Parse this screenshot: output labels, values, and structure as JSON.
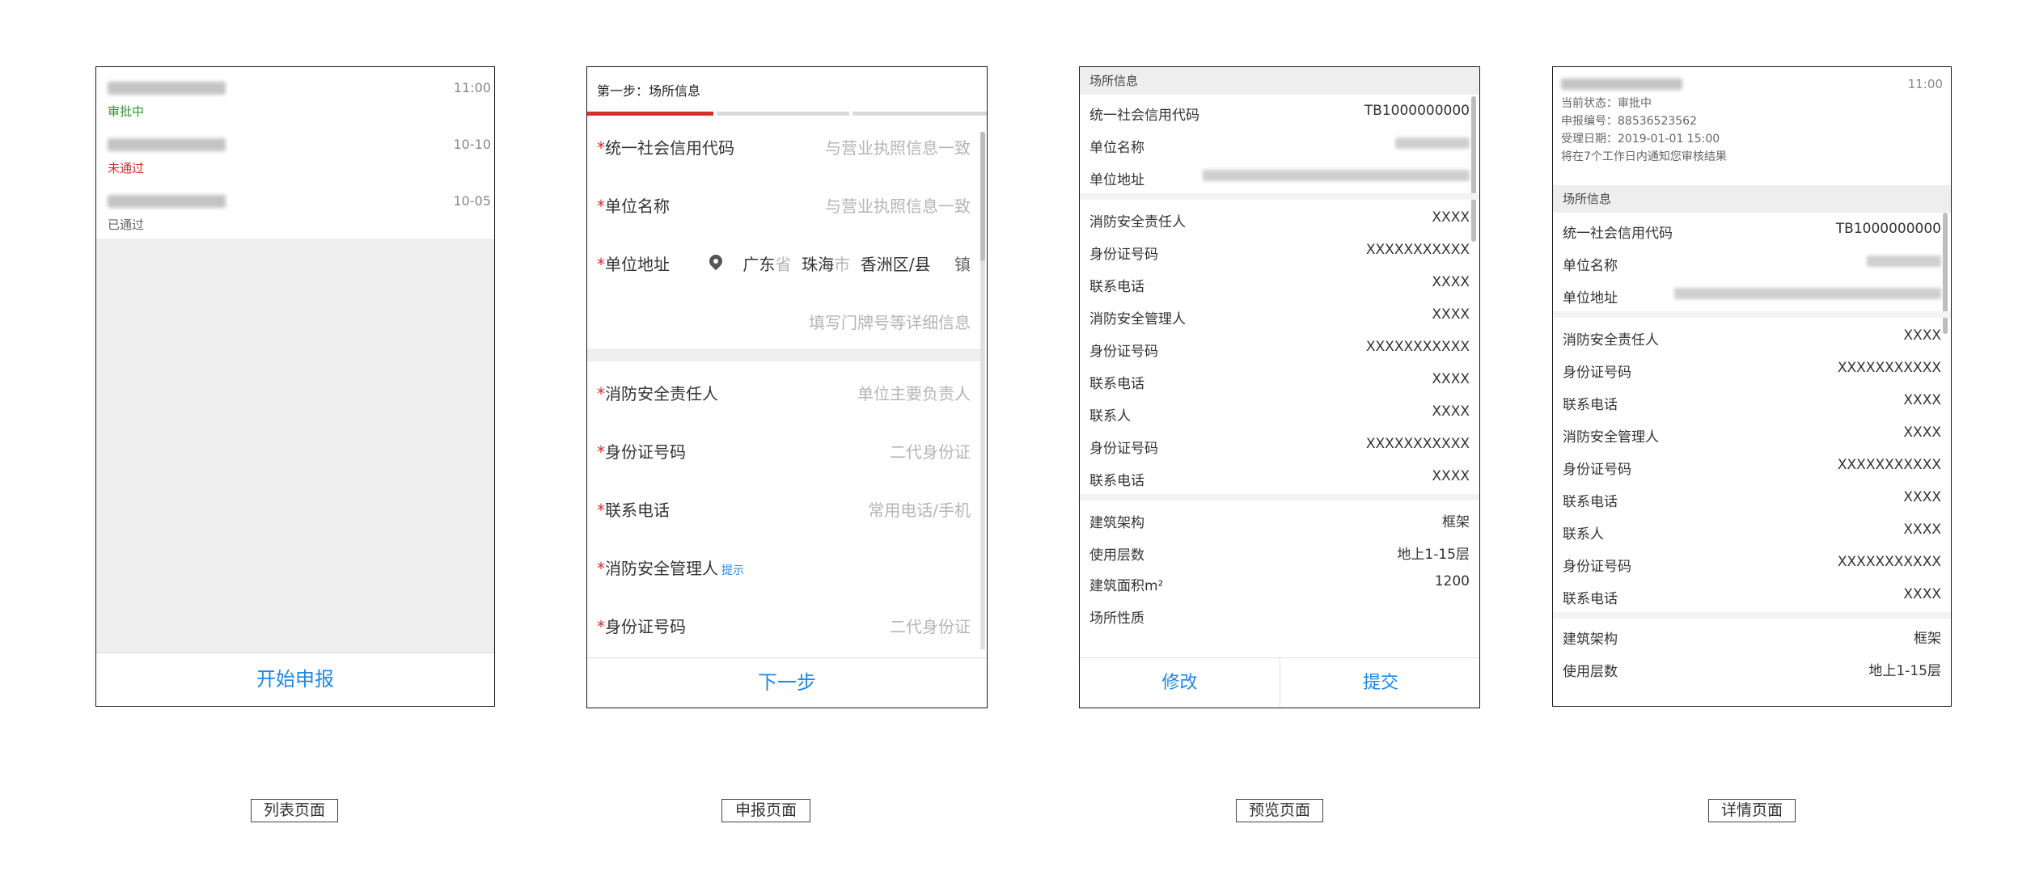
{
  "list_page": {
    "items": [
      {
        "status": "审批中",
        "status_color": "#2e9a2e",
        "time": "11:00"
      },
      {
        "status": "未通过",
        "status_color": "#d32f2f",
        "time": "10-10"
      },
      {
        "status": "已通过",
        "status_color": "#666666",
        "time": "10-05"
      }
    ],
    "start_button": "开始申报",
    "caption": "列表页面"
  },
  "form_page": {
    "step_title": "第一步：场所信息",
    "fields": [
      {
        "label": "统一社会信用代码",
        "placeholder": "与营业执照信息一致"
      },
      {
        "label": "单位名称",
        "placeholder": "与营业执照信息一致"
      },
      {
        "label": "单位地址"
      },
      {
        "placeholder": "填写门牌号等详细信息"
      },
      {
        "label": "消防安全责任人",
        "placeholder": "单位主要负责人"
      },
      {
        "label": "身份证号码",
        "placeholder": "二代身份证"
      },
      {
        "label": "联系电话",
        "placeholder": "常用电话/手机"
      },
      {
        "label": "消防安全管理人",
        "hint": "提示"
      },
      {
        "label": "身份证号码",
        "placeholder": "二代身份证"
      }
    ],
    "required_mark": "*",
    "address": {
      "province": "广东",
      "province_unit": "省",
      "city": "珠海",
      "city_unit": "市",
      "district": "香洲区/县",
      "town": "镇"
    },
    "next_button": "下一步",
    "caption": "申报页面",
    "accent_color": "#d32f2f"
  },
  "preview_page": {
    "section_title": "场所信息",
    "org_rows": [
      {
        "label": "统一社会信用代码",
        "value": "TB1000000000"
      },
      {
        "label": "单位名称"
      },
      {
        "label": "单位地址"
      }
    ],
    "person_rows": [
      {
        "label": "消防安全责任人",
        "value": "XXXX"
      },
      {
        "label": "身份证号码",
        "value": "XXXXXXXXXXX"
      },
      {
        "label": "联系电话",
        "value": "XXXX"
      },
      {
        "label": "消防安全管理人",
        "value": "XXXX"
      },
      {
        "label": "身份证号码",
        "value": "XXXXXXXXXXX"
      },
      {
        "label": "联系电话",
        "value": "XXXX"
      },
      {
        "label": "联系人",
        "value": "XXXX"
      },
      {
        "label": "身份证号码",
        "value": "XXXXXXXXXXX"
      },
      {
        "label": "联系电话",
        "value": "XXXX"
      }
    ],
    "building_rows": [
      {
        "label": "建筑架构",
        "value": "框架"
      },
      {
        "label": "使用层数",
        "value": "地上1-15层"
      },
      {
        "label": "建筑面积m²",
        "value": "1200"
      },
      {
        "label": "场所性质",
        "value": ""
      }
    ],
    "edit_button": "修改",
    "submit_button": "提交",
    "caption": "预览页面"
  },
  "detail_page": {
    "time": "11:00",
    "meta": [
      "当前状态：审批中",
      "申报编号：88536523562",
      "受理日期：2019-01-01 15:00",
      "将在7个工作日内通知您审核结果"
    ],
    "section_title": "场所信息",
    "org_rows": [
      {
        "label": "统一社会信用代码",
        "value": "TB1000000000"
      },
      {
        "label": "单位名称"
      },
      {
        "label": "单位地址"
      }
    ],
    "person_rows": [
      {
        "label": "消防安全责任人",
        "value": "XXXX"
      },
      {
        "label": "身份证号码",
        "value": "XXXXXXXXXXX"
      },
      {
        "label": "联系电话",
        "value": "XXXX"
      },
      {
        "label": "消防安全管理人",
        "value": "XXXX"
      },
      {
        "label": "身份证号码",
        "value": "XXXXXXXXXXX"
      },
      {
        "label": "联系电话",
        "value": "XXXX"
      },
      {
        "label": "联系人",
        "value": "XXXX"
      },
      {
        "label": "身份证号码",
        "value": "XXXXXXXXXXX"
      },
      {
        "label": "联系电话",
        "value": "XXXX"
      }
    ],
    "building_rows": [
      {
        "label": "建筑架构",
        "value": "框架"
      },
      {
        "label": "使用层数",
        "value": "地上1-15层"
      }
    ],
    "caption": "详情页面"
  }
}
